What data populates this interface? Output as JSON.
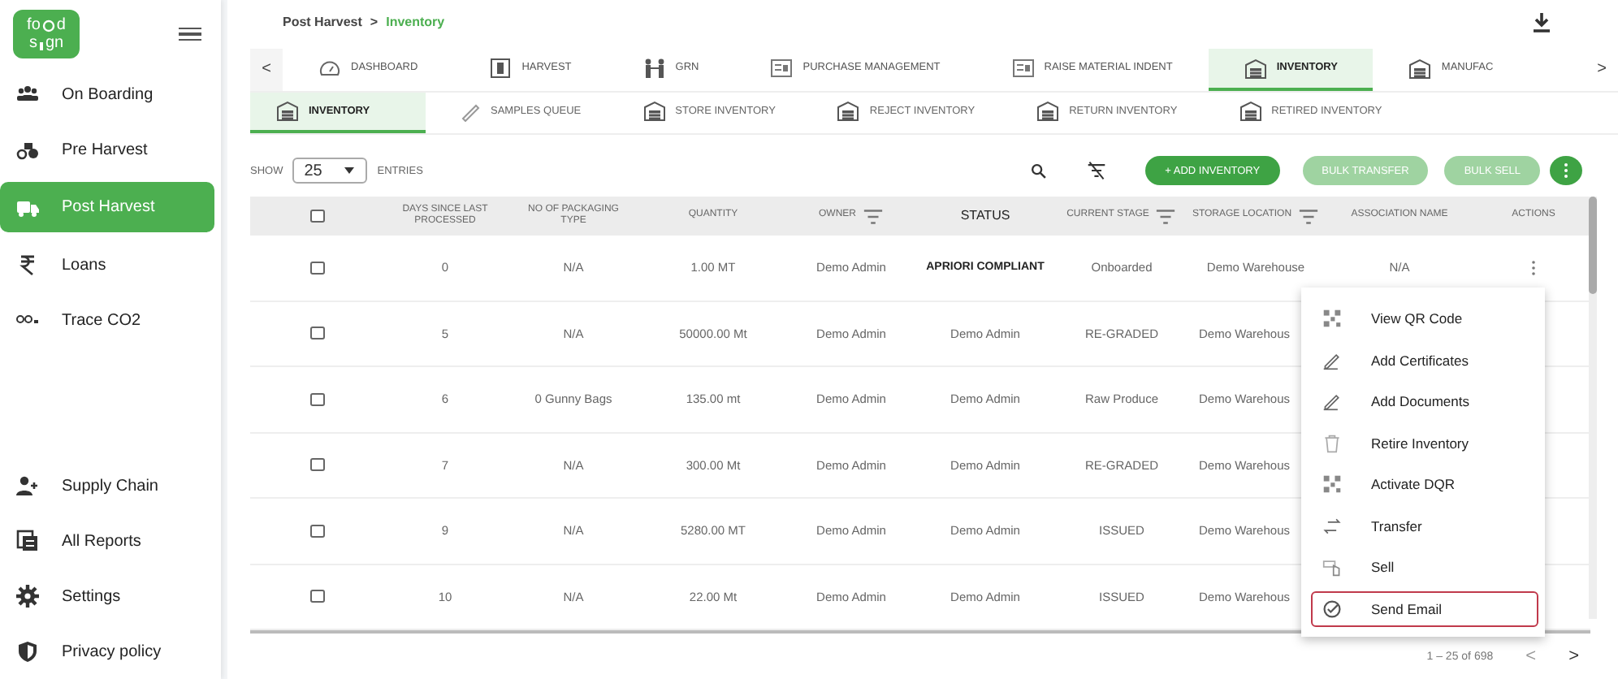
{
  "logo": {
    "parts": [
      "fo",
      "d",
      "s",
      "gn"
    ]
  },
  "sidebar": {
    "items": [
      {
        "label": "On Boarding",
        "selected": false
      },
      {
        "label": "Pre Harvest",
        "selected": false
      },
      {
        "label": "Post Harvest",
        "selected": true
      },
      {
        "label": "Loans",
        "selected": false
      },
      {
        "label": "Trace CO2",
        "selected": false
      }
    ],
    "bottom_items": [
      {
        "label": "Supply Chain"
      },
      {
        "label": "All Reports"
      },
      {
        "label": "Settings"
      },
      {
        "label": "Privacy policy"
      }
    ]
  },
  "breadcrumb": {
    "parent": "Post Harvest",
    "separator": ">",
    "current": "Inventory"
  },
  "tabs": [
    {
      "label": "DASHBOARD",
      "selected": false
    },
    {
      "label": "HARVEST",
      "selected": false
    },
    {
      "label": "GRN",
      "selected": false
    },
    {
      "label": "PURCHASE MANAGEMENT",
      "selected": false
    },
    {
      "label": "RAISE MATERIAL INDENT",
      "selected": false
    },
    {
      "label": "INVENTORY",
      "selected": true
    },
    {
      "label": "MANUFAC",
      "selected": false
    }
  ],
  "sub_tabs": [
    {
      "label": "INVENTORY",
      "selected": true
    },
    {
      "label": "SAMPLES QUEUE",
      "selected": false
    },
    {
      "label": "STORE INVENTORY",
      "selected": false
    },
    {
      "label": "REJECT INVENTORY",
      "selected": false
    },
    {
      "label": "RETURN INVENTORY",
      "selected": false
    },
    {
      "label": "RETIRED INVENTORY",
      "selected": false
    }
  ],
  "toolbar": {
    "show_label": "SHOW",
    "page_size": "25",
    "entries_label": "ENTRIES",
    "buttons": [
      {
        "label": "+ ADD INVENTORY",
        "disabled": false
      },
      {
        "label": "BULK TRANSFER",
        "disabled": true
      },
      {
        "label": "BULK SELL",
        "disabled": true
      }
    ]
  },
  "table": {
    "select_all_checked": false,
    "columns": [
      {
        "label": "DAYS SINCE LAST PROCESSED",
        "filterable": false
      },
      {
        "label": "NO OF PACKAGING TYPE",
        "filterable": false
      },
      {
        "label": "QUANTITY",
        "filterable": false
      },
      {
        "label": "OWNER",
        "filterable": true
      },
      {
        "label": "STATUS",
        "filterable": false
      },
      {
        "label": "CURRENT STAGE",
        "filterable": true
      },
      {
        "label": "STORAGE LOCATION",
        "filterable": true
      },
      {
        "label": "ASSOCIATION NAME",
        "filterable": false
      },
      {
        "label": "ACTIONS",
        "filterable": false
      }
    ],
    "rows": [
      {
        "checked": false,
        "days": "0",
        "packaging": "N/A",
        "quantity": "1.00 MT",
        "owner": "Demo Admin",
        "status": "APRIORI COMPLIANT",
        "status_bold": true,
        "stage": "Onboarded",
        "storage": "Demo Warehouse",
        "association": "N/A",
        "has_actions": true
      },
      {
        "checked": false,
        "days": "5",
        "packaging": "N/A",
        "quantity": "50000.00 Mt",
        "owner": "Demo Admin",
        "status": "Demo Admin",
        "status_bold": false,
        "stage": "RE-GRADED",
        "storage": "Demo Warehous"
      },
      {
        "checked": false,
        "days": "6",
        "packaging": "0 Gunny Bags",
        "quantity": "135.00 mt",
        "owner": "Demo Admin",
        "status": "Demo Admin",
        "status_bold": false,
        "stage": "Raw Produce",
        "storage": "Demo Warehous"
      },
      {
        "checked": false,
        "days": "7",
        "packaging": "N/A",
        "quantity": "300.00 Mt",
        "owner": "Demo Admin",
        "status": "Demo Admin",
        "status_bold": false,
        "stage": "RE-GRADED",
        "storage": "Demo Warehous"
      },
      {
        "checked": false,
        "days": "9",
        "packaging": "N/A",
        "quantity": "5280.00 MT",
        "owner": "Demo Admin",
        "status": "Demo Admin",
        "status_bold": false,
        "stage": "ISSUED",
        "storage": "Demo Warehous"
      },
      {
        "checked": false,
        "days": "10",
        "packaging": "N/A",
        "quantity": "22.00 Mt",
        "owner": "Demo Admin",
        "status": "Demo Admin",
        "status_bold": false,
        "stage": "ISSUED",
        "storage": "Demo Warehous"
      }
    ]
  },
  "action_menu": {
    "items": [
      {
        "label": "View QR Code",
        "selected": false
      },
      {
        "label": "Add Certificates",
        "selected": false
      },
      {
        "label": "Add Documents",
        "selected": false
      },
      {
        "label": "Retire Inventory",
        "selected": false
      },
      {
        "label": "Activate DQR",
        "selected": false
      },
      {
        "label": "Transfer",
        "selected": false
      },
      {
        "label": "Sell",
        "selected": false
      },
      {
        "label": "Send Email",
        "selected": true
      }
    ]
  },
  "pagination": {
    "range": "1 – 25 of 698",
    "prev": "<",
    "next": ">"
  },
  "tab_nav": {
    "prev": "<",
    "next": ">"
  }
}
